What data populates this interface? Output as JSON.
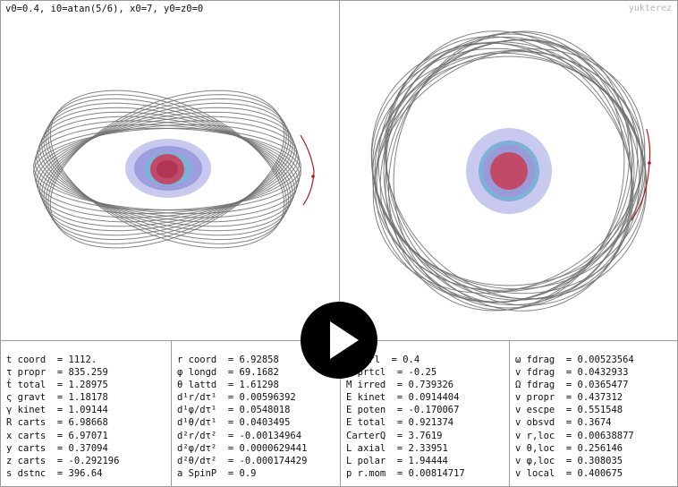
{
  "caption": "v0=0.4, i0=atan(5/6), x0=7, y0=z0=0",
  "watermark": "yukterez",
  "colors": {
    "orbit": "#6f6f6f",
    "trail": "#b01818"
  },
  "play_icon": "play-icon",
  "stats": [
    [
      "t coord  = 1112.",
      "τ propr  = 835.259",
      "ṫ total  = 1.28975",
      "ς gravt  = 1.18178",
      "γ kinet  = 1.09144",
      "R carts  = 6.98668",
      "x carts  = 6.97071",
      "y carts  = 0.37094",
      "z carts  = -0.292196",
      "s dstnc  = 396.64"
    ],
    [
      "r coord  = 6.92858",
      "φ longd  = 69.1682",
      "θ lattd  = 1.61298",
      "d¹r/dτ¹  = 0.00596392",
      "d¹φ/dτ¹  = 0.0548018",
      "d¹θ/dτ¹  = 0.0403495",
      "d²r/dτ²  = -0.00134964",
      "d²φ/dτ²  = 0.0000629441",
      "d²θ/dτ²  = -0.000174429",
      "a SpinP  = 0.9"
    ],
    [
      "Q ctrl  = 0.4",
      "Q prtcl  = -0.25",
      "M irred  = 0.739326",
      "E kinet  = 0.0914404",
      "E poten  = -0.170067",
      "E total  = 0.921374",
      "CarterQ  = 3.7619",
      "L axial  = 2.33951",
      "L polar  = 1.94444",
      "p r.mom  = 0.00814717"
    ],
    [
      "ω fdrag  = 0.00523564",
      "v fdrag  = 0.0432933",
      "Ω fdrag  = 0.0365477",
      "v propr  = 0.437312",
      "v escpe  = 0.551548",
      "v obsvd  = 0.3674",
      "v r,loc  = 0.00638877",
      "v θ,loc  = 0.256146",
      "v φ,loc  = 0.308035",
      "v local  = 0.400675"
    ]
  ]
}
